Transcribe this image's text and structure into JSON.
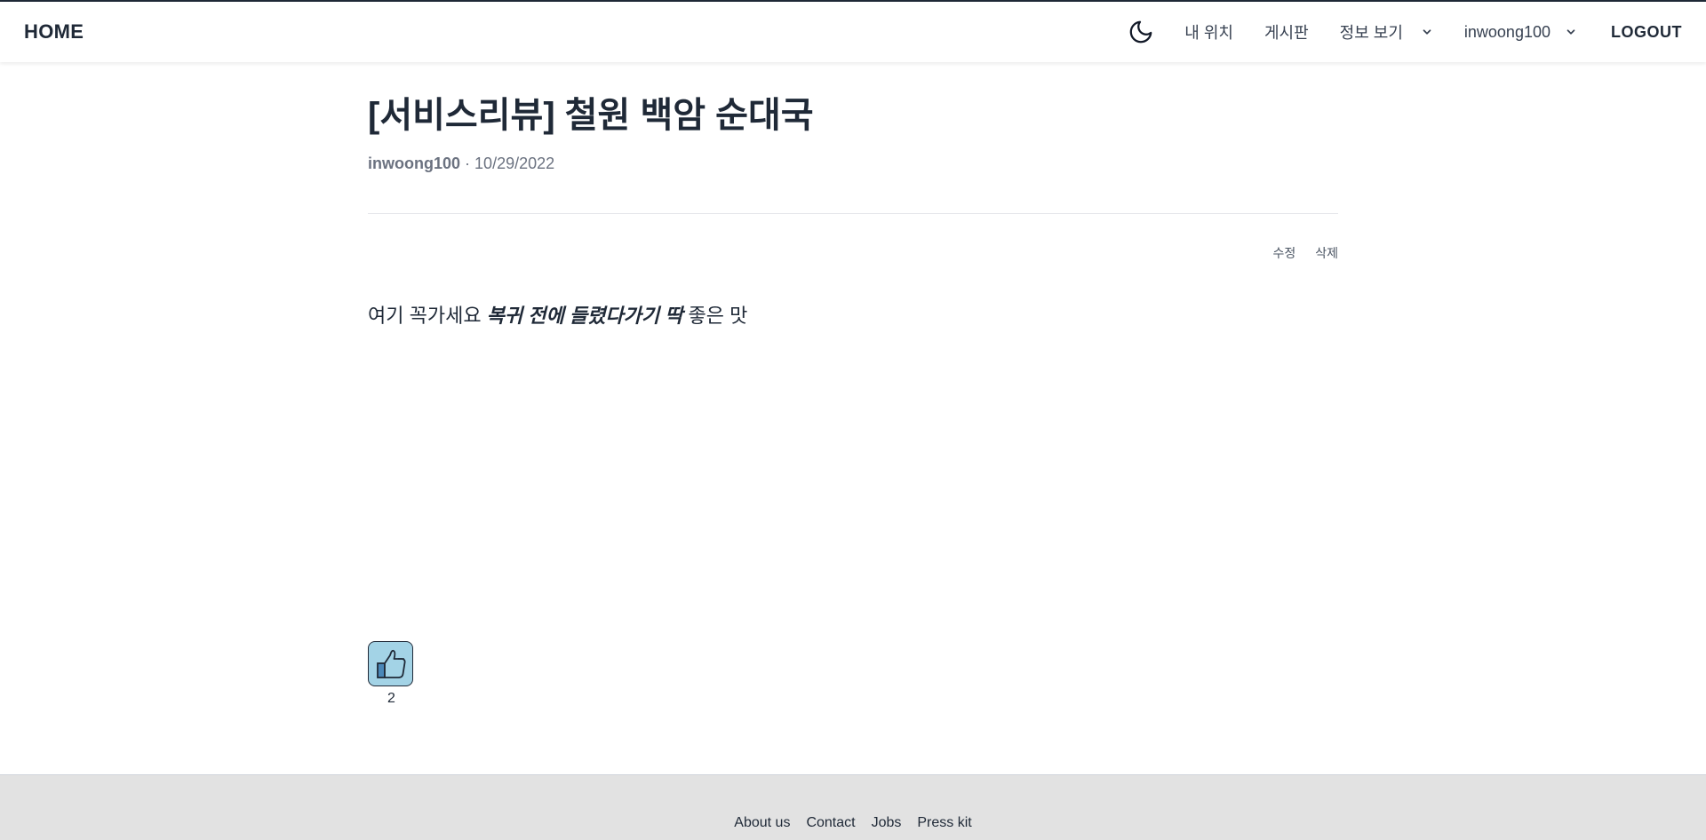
{
  "header": {
    "brand": "HOME",
    "theme_icon": "moon-icon",
    "nav": {
      "my_location": "내 위치",
      "board": "게시판",
      "info": "정보 보기",
      "user": "inwoong100",
      "logout": "LOGOUT"
    }
  },
  "post": {
    "title": "[서비스리뷰] 철원 백암 순대국",
    "author": "inwoong100",
    "separator": "·",
    "date": "10/29/2022",
    "actions": {
      "edit": "수정",
      "delete": "삭제"
    },
    "body": {
      "before": "여기 꼭가세요 ",
      "emphasis": "복귀 전에 들렸다가기 딱",
      "after": " 좋은 맛"
    },
    "likes": "2",
    "like_icon": "thumbs-up-icon"
  },
  "footer": {
    "links": [
      "About us",
      "Contact",
      "Jobs",
      "Press kit"
    ]
  },
  "colors": {
    "text": "#1f2937",
    "muted": "#6b7280",
    "like_bg": "#a3d3e6",
    "footer_bg": "#e2e2e2"
  }
}
